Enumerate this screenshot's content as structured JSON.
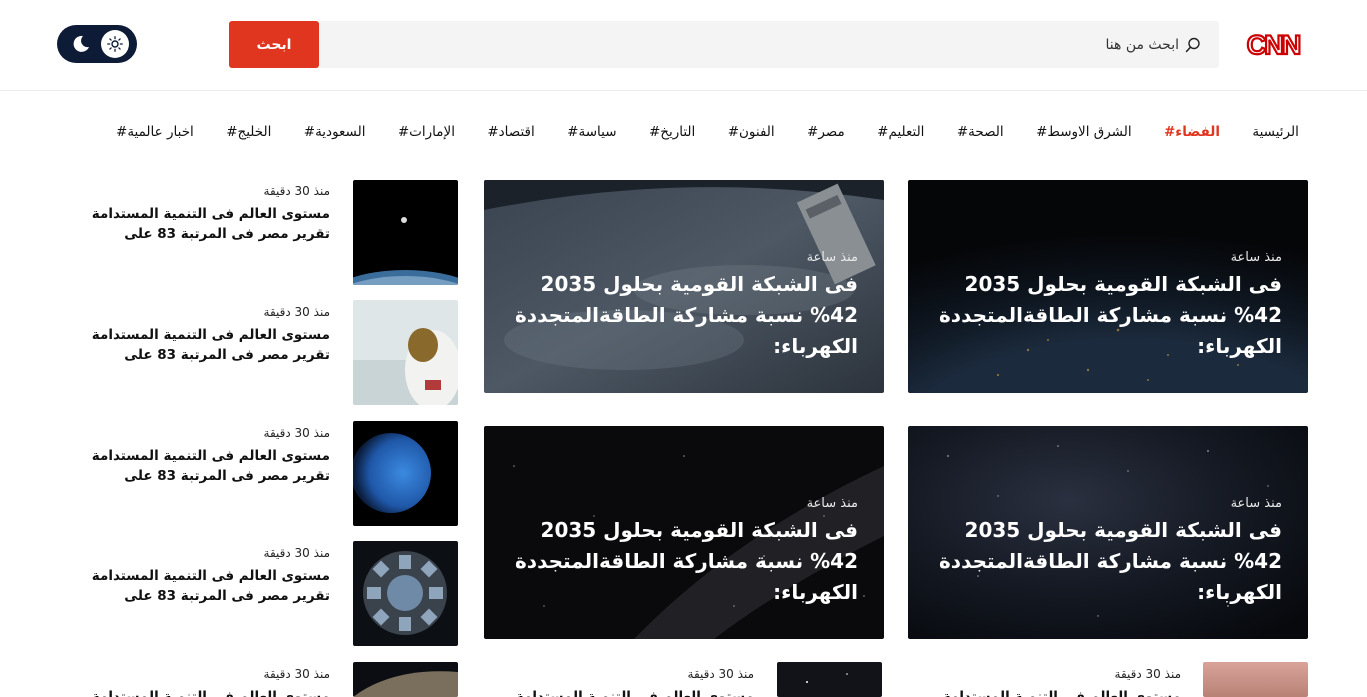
{
  "brand": {
    "logo_text": "CNN",
    "accent": "#e0351e",
    "dark": "#0d1b36"
  },
  "search": {
    "placeholder": "ابحث من هنا",
    "button_label": "ابحث"
  },
  "theme_toggle": {
    "icons": [
      "moon-icon",
      "sun-icon"
    ]
  },
  "nav": {
    "items": [
      {
        "label": "الرئيسية",
        "active": false
      },
      {
        "label": "#الفضاء",
        "active": true
      },
      {
        "label": "#الشرق الاوسط",
        "active": false
      },
      {
        "label": "#الصحة",
        "active": false
      },
      {
        "label": "#التعليم",
        "active": false
      },
      {
        "label": "#مصر",
        "active": false
      },
      {
        "label": "#الفنون",
        "active": false
      },
      {
        "label": "#التاريخ",
        "active": false
      },
      {
        "label": "#سياسة",
        "active": false
      },
      {
        "label": "#اقتصاد",
        "active": false
      },
      {
        "label": "#الإمارات",
        "active": false
      },
      {
        "label": "#السعودية",
        "active": false
      },
      {
        "label": "#الخليج",
        "active": false
      },
      {
        "label": "#اخبار عالمية",
        "active": false
      }
    ]
  },
  "featured": [
    {
      "time": "منذ ساعة",
      "title": "فى الشبكة القومية بحلول 2035 42% نسبة مشاركة الطاقةالمتجددة الكهرباء:"
    },
    {
      "time": "منذ ساعة",
      "title": "فى الشبكة القومية بحلول 2035 42% نسبة مشاركة الطاقةالمتجددة الكهرباء:"
    },
    {
      "time": "منذ ساعة",
      "title": "فى الشبكة القومية بحلول 2035 42% نسبة مشاركة الطاقةالمتجددة الكهرباء:"
    },
    {
      "time": "منذ ساعة",
      "title": "فى الشبكة القومية بحلول 2035 42% نسبة مشاركة الطاقةالمتجددة الكهرباء:"
    }
  ],
  "sidebar": [
    {
      "time": "منذ 30 دقيقة",
      "line1": "مستوى العالم فى التنمية المستدامة",
      "line2": "تقرير  مصر فى المرتبة 83 على"
    },
    {
      "time": "منذ 30 دقيقة",
      "line1": "مستوى العالم فى التنمية المستدامة",
      "line2": "تقرير  مصر فى المرتبة 83 على"
    },
    {
      "time": "منذ 30 دقيقة",
      "line1": "مستوى العالم فى التنمية المستدامة",
      "line2": "تقرير  مصر فى المرتبة 83 على"
    },
    {
      "time": "منذ 30 دقيقة",
      "line1": "مستوى العالم فى التنمية المستدامة",
      "line2": "تقرير  مصر فى المرتبة 83 على"
    },
    {
      "time": "منذ 30 دقيقة",
      "line1": "مستوى العالم فى التنمية المستدامة",
      "line2": ""
    }
  ],
  "bottom_row": [
    {
      "time": "منذ 30 دقيقة",
      "line1": "مستوى العالم فى التنمية المستدامة"
    },
    {
      "time": "منذ 30 دقيقة",
      "line1": "مستوى العالم فى التنمية المستدامة"
    }
  ]
}
